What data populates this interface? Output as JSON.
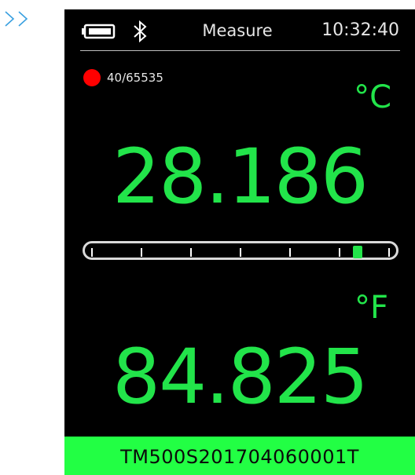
{
  "nav": {
    "chevron_icon": "double-chevron-right-icon",
    "color": "#3aa0e0"
  },
  "status_bar": {
    "battery_icon": "battery-icon",
    "bluetooth_icon": "bluetooth-icon",
    "title": "Measure",
    "time": "10:32:40"
  },
  "recording": {
    "indicator_color": "#ff0000",
    "count": "40/65535"
  },
  "celsius": {
    "unit": "°C",
    "value": "28.186"
  },
  "level_indicator": {
    "tick_count": 7,
    "position_fraction": 0.88
  },
  "fahrenheit": {
    "unit": "°F",
    "value": "84.825"
  },
  "footer": {
    "serial": "TM500S201704060001T",
    "color": "#22ff44"
  },
  "colors": {
    "accent": "#22e44a",
    "background": "#000000",
    "text": "#e6e6e6"
  }
}
